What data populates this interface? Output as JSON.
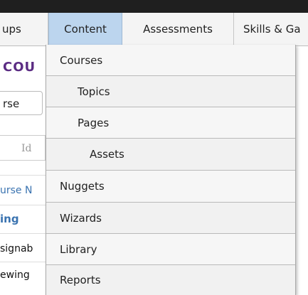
{
  "nav": {
    "tabs": [
      {
        "label": "ups"
      },
      {
        "label": "Content"
      },
      {
        "label": "Assessments"
      },
      {
        "label": "Skills & Ga"
      }
    ]
  },
  "background": {
    "page_heading": "COU",
    "course_button": "rse",
    "id_placeholder": "Id",
    "column_header": "urse N",
    "row_title": "ing",
    "rows": [
      "signab",
      "ewing"
    ]
  },
  "dropdown": {
    "items": [
      {
        "label": "Courses"
      },
      {
        "label": "Topics"
      },
      {
        "label": "Pages"
      },
      {
        "label": "Assets"
      },
      {
        "label": "Nuggets"
      },
      {
        "label": "Wizards"
      },
      {
        "label": "Library"
      },
      {
        "label": "Reports"
      }
    ]
  }
}
